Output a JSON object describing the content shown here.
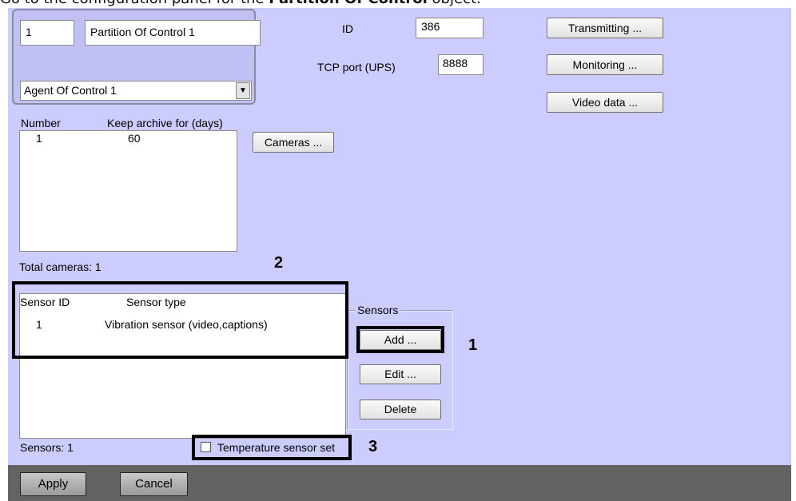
{
  "caption": {
    "prefix": "Go to the configuration panel for the ",
    "bold": "Partition Of Control",
    "suffix": " object."
  },
  "object": {
    "number": "1",
    "name": "Partition Of Control 1",
    "agent": "Agent Of Control 1"
  },
  "id": {
    "label": "ID",
    "value": "386"
  },
  "tcp": {
    "label": "TCP port (UPS)",
    "value": "8888"
  },
  "buttons": {
    "transmitting": "Transmitting ...",
    "monitoring": "Monitoring ...",
    "video_data": "Video data ...",
    "cameras": "Cameras ...",
    "add": "Add ...",
    "edit": "Edit ...",
    "delete": "Delete",
    "apply": "Apply",
    "cancel": "Cancel"
  },
  "cameras_table": {
    "headers": [
      "Number",
      "Keep archive for (days)"
    ],
    "rows": [
      [
        "1",
        "60"
      ]
    ],
    "total": "Total cameras: 1"
  },
  "sensors_table": {
    "headers": [
      "Sensor ID",
      "Sensor type"
    ],
    "rows": [
      [
        "1",
        "Vibration sensor  (video,captions)"
      ]
    ],
    "total": "Sensors: 1"
  },
  "sensors_group": {
    "title": "Sensors"
  },
  "temperature_checkbox": {
    "label": "Temperature sensor set",
    "checked": false
  },
  "callouts": {
    "one": "1",
    "two": "2",
    "three": "3"
  },
  "icons": {
    "dropdown": "chevron-down-icon"
  },
  "colors": {
    "panel_bg": "#ccccff",
    "bottom_bar": "#636363",
    "highlight": "#000000"
  }
}
